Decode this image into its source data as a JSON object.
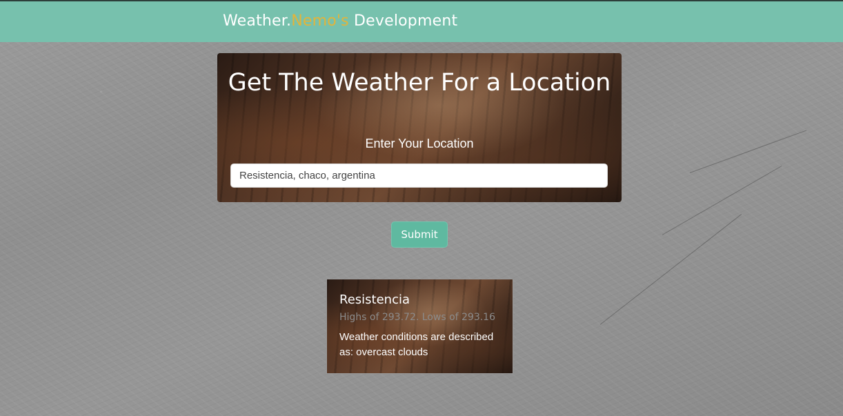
{
  "navbar": {
    "brand_prefix": "Weather.",
    "brand_accent": "Nemo's",
    "brand_suffix": " Development",
    "background_color": "#77c1ad",
    "accent_color": "#e3b43a"
  },
  "hero": {
    "title": "Get The Weather For a Location",
    "subtitle": "Enter Your Location",
    "location_input_value": "Resistencia, chaco, argentina"
  },
  "submit_label": "Submit",
  "result": {
    "city": "Resistencia",
    "temps": "Highs of 293.72. Lows of 293.16",
    "description": "Weather conditions are described as: overcast clouds"
  }
}
